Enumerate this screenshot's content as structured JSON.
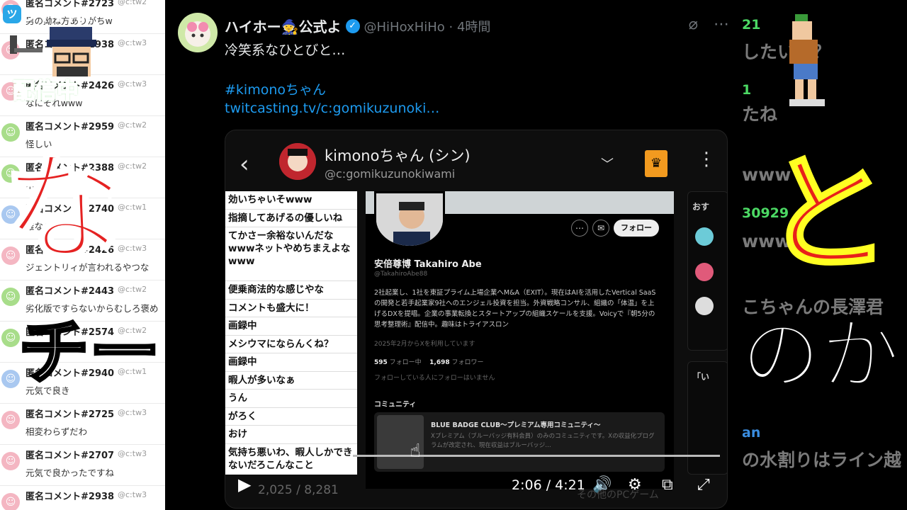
{
  "logo": {
    "mark": "ツ",
    "text": "ツイキャス"
  },
  "live_badge": "配信中",
  "comments": [
    {
      "name": "匿名コメント#2723",
      "user": "@c:tw2",
      "text": "男の拗ね方ありがちw",
      "color": "#f4b6c2",
      "face": "☺"
    },
    {
      "name": "匿名コメント#2938",
      "user": "@c:tw3",
      "text": "",
      "color": "#f4b6c2",
      "face": "☺"
    },
    {
      "name": "匿名コメント#2426",
      "user": "@c:tw3",
      "text": "なにそれwww",
      "color": "#f4b6c2",
      "face": "☺"
    },
    {
      "name": "匿名コメント#2959",
      "user": "@c:tw2",
      "text": "怪しい",
      "color": "#a8dd8a",
      "face": "☺"
    },
    {
      "name": "匿名コメント#2388",
      "user": "@c:tw2",
      "text": "ネ",
      "color": "#a8dd8a",
      "face": "☺"
    },
    {
      "name": "匿名コメント#2740",
      "user": "@c:tw1",
      "text": "誰なの？",
      "color": "#a9c8f0",
      "face": "☺"
    },
    {
      "name": "匿名コメント#2426",
      "user": "@c:tw3",
      "text": "ジェントリィが言われるやつな",
      "color": "#f4b6c2",
      "face": "☺"
    },
    {
      "name": "匿名コメント#2443",
      "user": "@c:tw2",
      "text": "劣化版ですらないからむしろ褒め",
      "color": "#a8dd8a",
      "face": "☺"
    },
    {
      "name": "匿名コメント#2574",
      "user": "@c:tw2",
      "text": "",
      "color": "#a8dd8a",
      "face": "☺"
    },
    {
      "name": "匿名コメント#2940",
      "user": "@c:tw1",
      "text": "元気で良き",
      "color": "#a9c8f0",
      "face": "☺"
    },
    {
      "name": "匿名コメント#2725",
      "user": "@c:tw3",
      "text": "相変わらずだわ",
      "color": "#f4b6c2",
      "face": "☺"
    },
    {
      "name": "匿名コメント#2707",
      "user": "@c:tw3",
      "text": "元気で良かったですね",
      "color": "#f4b6c2",
      "face": "☺"
    },
    {
      "name": "匿名コメント#2938",
      "user": "@c:tw3",
      "text": "",
      "color": "#f4b6c2",
      "face": "☺"
    }
  ],
  "tweet": {
    "display_name": "ハイホー🧙公式よ",
    "handle": "@HiHoxHiHo · 4時間",
    "text": "冷笑系なひとびと…",
    "hashtag": "#kimonoちゃん",
    "link": "twitcasting.tv/c:gomikuzunoki…",
    "icons": {
      "grok": "⌀",
      "more": "⋯"
    }
  },
  "media": {
    "back": "‹",
    "name": "kimonoちゃん (シン)",
    "handle": "@c:gomikuzunokiwami",
    "chevron": "﹀",
    "crown": "♛",
    "more": "⋮",
    "list": [
      "効いちゃいそwww",
      "指摘してあげるの優しいね",
      "てかさー余裕ないんだなwwwネットやめちまえよなwww",
      "便乗商法的な感じやな",
      "コメントも盛大に！",
      "画録中",
      "メシウマにならんくね？",
      "画録中",
      "暇人が多いなぁ",
      "うん",
      "がろく",
      "おけ",
      "気持ち悪いわ、暇人しかできないだろこんなこと"
    ],
    "profile": {
      "name": "安倍尊博 Takahiro Abe",
      "handle": "@TakahiroAbe88",
      "bio": "2社起業し、1社を東証プライム上場企業へM&A（EXIT）。現在はAIを活用したVertical SaaSの開発と若手起業家9社へのエンジェル投資を担当。外資戦略コンサル、組織の「体温」を上げるDXを提唱。企業の事業転換とスタートアップの組織スケールを支援。Voicyで『朝5分の思考整理術』配信中。趣味はトライアスロン",
      "joined": "2025年2月からXを利用しています",
      "following_count": "595",
      "following_label": "フォロー中",
      "followers_count": "1,698",
      "followers_label": "フォロワー",
      "no_follow": "フォローしている人にフォローはいません",
      "follow": "フォロー",
      "community_label": "コミュニティ",
      "community_title": "BLUE BADGE CLUB〜プレミアム専用コミュニティ〜",
      "community_desc": "Xプレミアム（ブルーバッジ有料会員）のみのコミュニティです。Xの収益化プログラムが改定され、現在収益はブルーバッジ…",
      "side_title": "おす",
      "side_title2": "「い"
    },
    "views": "2,025 / 8,281",
    "time": "2:06 / 4:21",
    "other": "その他のPCゲーム",
    "controls": {
      "play": "▶",
      "volume": "🔊",
      "settings": "⚙",
      "pip": "⧉",
      "fullscreen": "⤢"
    }
  },
  "right": {
    "lines": [
      {
        "text": "21",
        "color": "#4cd964",
        "size": "small"
      },
      {
        "text": "したい人？",
        "color": "#7a7a7a",
        "size": "big"
      },
      {
        "text": "1",
        "color": "#4cd964",
        "size": "small"
      },
      {
        "text": "たね",
        "color": "#7a7a7a",
        "size": "big"
      },
      {
        "text": "www",
        "color": "#7a7a7a",
        "size": "big"
      },
      {
        "text": "30929",
        "color": "#4cd964",
        "size": "small"
      },
      {
        "text": "www",
        "color": "#7a7a7a",
        "size": "big"
      },
      {
        "text": "こちゃんの長澤君",
        "color": "#7a7a7a",
        "size": "big"
      },
      {
        "text": "an",
        "color": "#3a8de0",
        "size": "small"
      },
      {
        "text": "の水割りはライン越",
        "color": "#7a7a7a",
        "size": "big"
      }
    ]
  },
  "overlay": {
    "na": "な",
    "chi": "チー",
    "to": "と",
    "noka": "のか"
  }
}
